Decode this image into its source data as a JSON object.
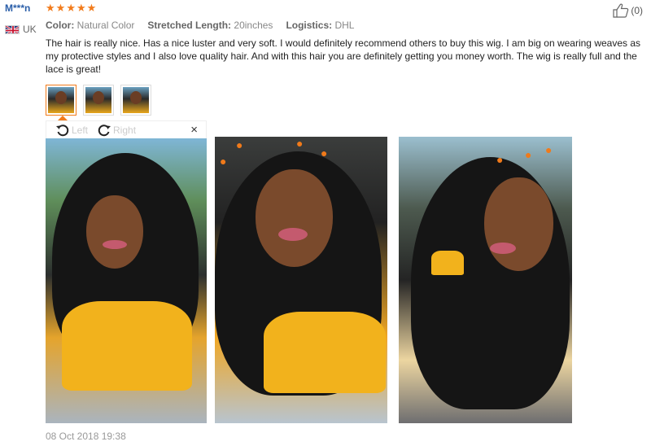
{
  "reviewer": {
    "name": "M***n",
    "country": "UK",
    "flag_icon": "uk-flag-icon"
  },
  "rating": {
    "stars": 5,
    "max": 5,
    "star_color": "#f27b1b"
  },
  "helpful": {
    "count_label": "(0)",
    "icon": "thumbs-up-icon"
  },
  "attributes": [
    {
      "key": "Color:",
      "value": "Natural Color"
    },
    {
      "key": "Stretched Length:",
      "value": "20inches"
    },
    {
      "key": "Logistics:",
      "value": "DHL"
    }
  ],
  "review_text": "The hair is really nice. Has a nice luster and very soft. I would definitely recommend others to buy this wig. I am big on wearing weaves as my protective styles and I also love quality hair. And with this hair you are definitely getting you money worth. The wig is really full and the lace is great!",
  "viewer": {
    "rotate_left_label": "Left",
    "rotate_right_label": "Right",
    "close_label": "×",
    "selected_index": 0
  },
  "thumbnails": [
    {
      "alt": "review photo 1"
    },
    {
      "alt": "review photo 2"
    },
    {
      "alt": "review photo 3"
    }
  ],
  "date": "08 Oct 2018 19:38",
  "colors": {
    "name_blue": "#2a5ea8",
    "accent_orange": "#f27b1b"
  }
}
